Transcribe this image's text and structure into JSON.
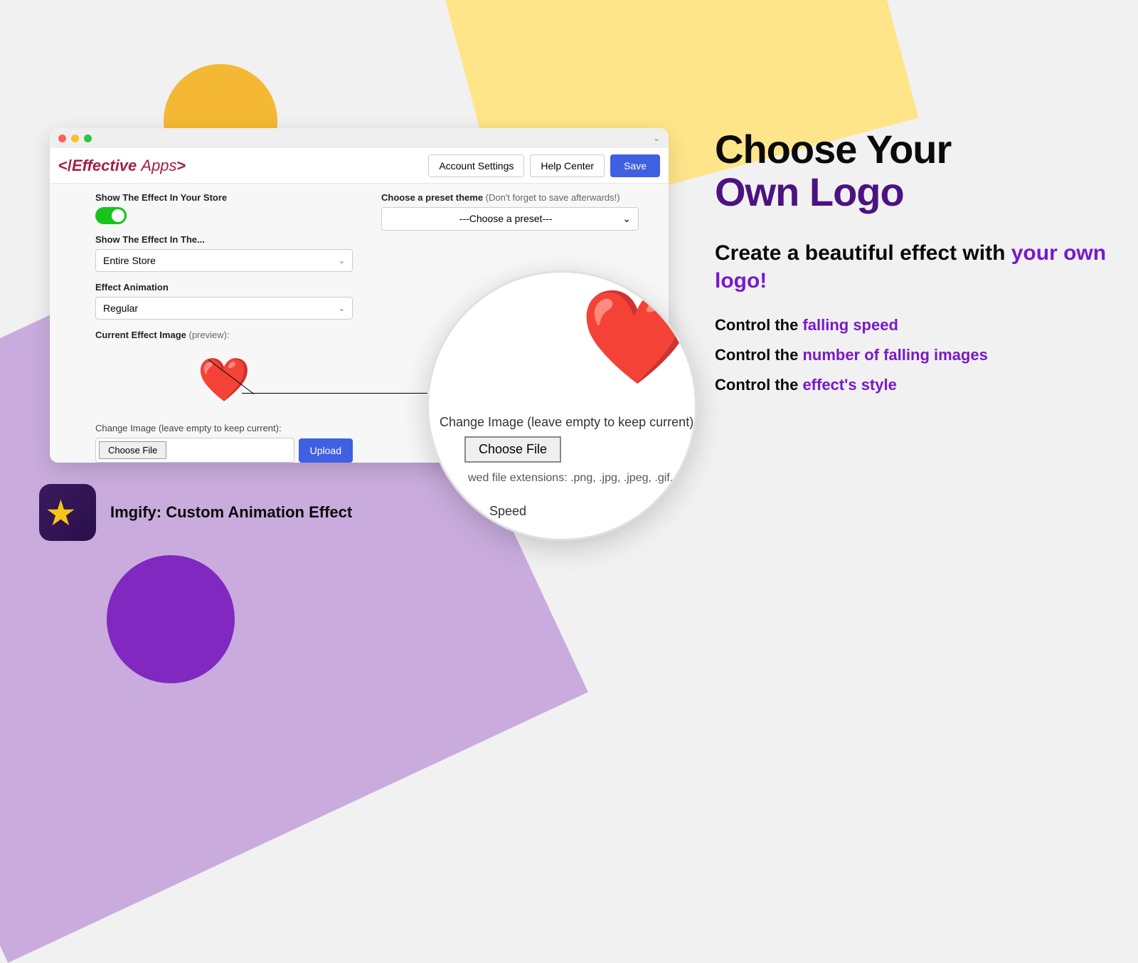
{
  "header": {
    "logo_text": "</Effective Apps>",
    "account_settings": "Account Settings",
    "help_center": "Help Center",
    "save": "Save"
  },
  "left": {
    "show_effect_label": "Show The Effect In Your Store",
    "show_in_label": "Show The Effect In The...",
    "show_in_value": "Entire Store",
    "animation_label": "Effect Animation",
    "animation_value": "Regular",
    "current_image_label": "Current Effect Image",
    "current_image_hint": "(preview):",
    "change_image_label": "Change Image (leave empty to keep current):",
    "choose_file": "Choose File",
    "upload": "Upload"
  },
  "right": {
    "preset_label": "Choose a preset theme",
    "preset_hint": "(Don't forget to save afterwards!)",
    "preset_value": "---Choose a preset---"
  },
  "zoom": {
    "line1": "Change Image (leave empty to keep current)",
    "choose_file": "Choose File",
    "line2": "wed file extensions: .png, .jpg, .jpeg, .gif, .bmp;",
    "line3": "Speed"
  },
  "app": {
    "name": "Imgify: Custom Animation Effect"
  },
  "marketing": {
    "h1_l1": "Choose Your",
    "h1_l2": "Own Logo",
    "sub_p1": "Create a beautiful effect with ",
    "sub_accent": "your own logo!",
    "feat1_pre": "Control the ",
    "feat1_accent": "falling speed",
    "feat2_pre": "Control the ",
    "feat2_accent": "number of falling images",
    "feat3_pre": "Control the ",
    "feat3_accent": "effect's style"
  }
}
